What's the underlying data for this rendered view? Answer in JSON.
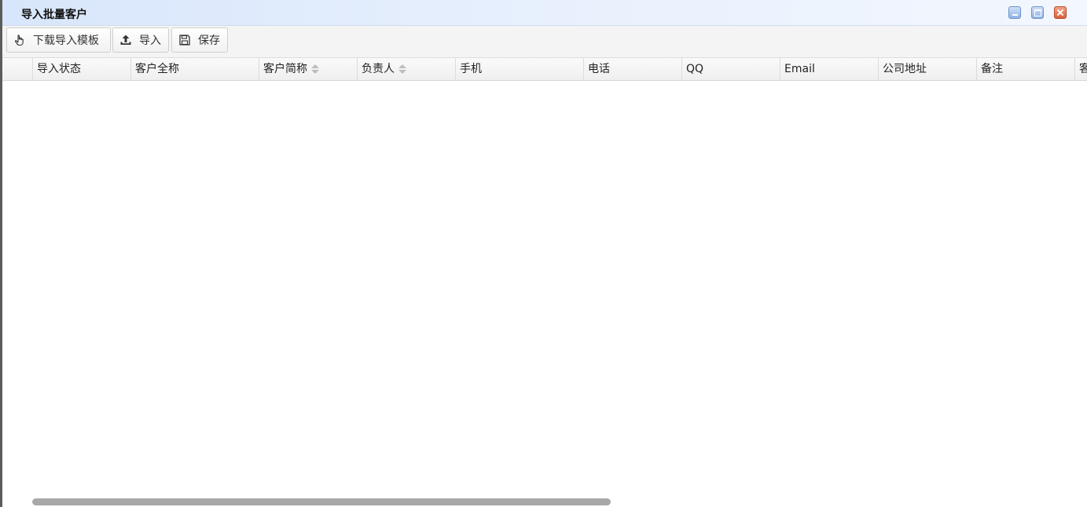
{
  "window": {
    "title": "导入批量客户",
    "buttons": [
      "minimize",
      "maximize",
      "close"
    ],
    "close_color": "#d9603d",
    "accent_color": "#90b4e6"
  },
  "toolbar": {
    "download_template": {
      "label": "下载导入模板",
      "icon": "hand-pointer-icon"
    },
    "import": {
      "label": "导入",
      "icon": "upload-icon"
    },
    "save": {
      "label": "保存",
      "icon": "floppy-disk-icon"
    }
  },
  "grid": {
    "columns": [
      {
        "label": "",
        "sortable": false
      },
      {
        "label": "导入状态",
        "sortable": false
      },
      {
        "label": "客户全称",
        "sortable": false
      },
      {
        "label": "客户简称",
        "sortable": true
      },
      {
        "label": "负责人",
        "sortable": true
      },
      {
        "label": "手机",
        "sortable": false
      },
      {
        "label": "电话",
        "sortable": false
      },
      {
        "label": "QQ",
        "sortable": false
      },
      {
        "label": "Email",
        "sortable": false
      },
      {
        "label": "公司地址",
        "sortable": false
      },
      {
        "label": "备注",
        "sortable": false
      },
      {
        "label": "客",
        "sortable": false
      }
    ],
    "rows": []
  }
}
